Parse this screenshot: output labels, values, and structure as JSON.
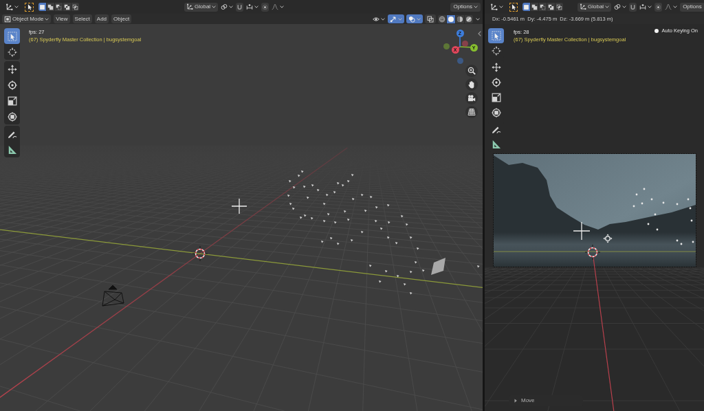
{
  "viewports": [
    {
      "kind": "perspective",
      "header": {
        "select_modes": [
          {
            "kind": "set",
            "selected": true
          },
          {
            "kind": "extend",
            "selected": false
          },
          {
            "kind": "subtract",
            "selected": false
          },
          {
            "kind": "invert",
            "selected": false
          },
          {
            "kind": "intersect",
            "selected": false
          }
        ],
        "orientation": "Global",
        "options": "Options",
        "options_caret": true,
        "mode": "Object Mode",
        "menus": [
          "View",
          "Select",
          "Add",
          "Object"
        ],
        "toggles": [
          {
            "kind": "visibility",
            "on": false
          },
          {
            "kind": "gizmos",
            "on": true
          },
          {
            "kind": "overlays",
            "on": true
          },
          {
            "kind": "xray",
            "on": false
          }
        ],
        "shading": [
          {
            "kind": "wireframe",
            "selected": false
          },
          {
            "kind": "solid",
            "selected": true
          },
          {
            "kind": "material",
            "selected": false
          },
          {
            "kind": "rendered",
            "selected": false
          }
        ]
      },
      "toolbar": [
        {
          "tools": [
            {
              "kind": "select",
              "selected": true
            },
            {
              "kind": "cursor",
              "selected": false
            }
          ]
        },
        {
          "tools": [
            {
              "kind": "move",
              "selected": false
            },
            {
              "kind": "rotate",
              "selected": false
            },
            {
              "kind": "scale",
              "selected": false
            },
            {
              "kind": "transform",
              "selected": false
            }
          ]
        },
        {
          "tools": [
            {
              "kind": "annotate",
              "selected": false
            },
            {
              "kind": "measure",
              "selected": false
            }
          ]
        }
      ],
      "info": {
        "fps": "fps: 27",
        "collection": "(67) Spyderfly Master Collection | bugsystemgoal"
      },
      "gizmo": {
        "axes": [
          {
            "label": "X",
            "color": "#e2465b"
          },
          {
            "label": "Y",
            "color": "#86bd2f"
          },
          {
            "label": "Z",
            "color": "#3d7ddb"
          }
        ]
      },
      "navigation": [
        {
          "kind": "zoom"
        },
        {
          "kind": "pan"
        },
        {
          "kind": "camera"
        },
        {
          "kind": "ortho"
        }
      ]
    },
    {
      "kind": "camera",
      "header": {
        "select_modes": [
          {
            "kind": "set",
            "selected": true
          },
          {
            "kind": "extend",
            "selected": false
          },
          {
            "kind": "subtract",
            "selected": false
          },
          {
            "kind": "invert",
            "selected": false
          },
          {
            "kind": "intersect",
            "selected": false
          }
        ],
        "orientation": "Global",
        "options": "Options",
        "options_caret": false,
        "readout": "Dx: -0.5461 m  Dy: -4.475 m  Dz: -3.669 m (5.813 m)"
      },
      "toolbar": [
        {
          "tools": [
            {
              "kind": "select",
              "selected": true
            },
            {
              "kind": "cursor",
              "selected": false
            }
          ]
        },
        {
          "tools": [
            {
              "kind": "move",
              "selected": false
            },
            {
              "kind": "rotate",
              "selected": false
            },
            {
              "kind": "scale",
              "selected": false
            },
            {
              "kind": "transform",
              "selected": false
            }
          ]
        },
        {
          "tools": [
            {
              "kind": "annotate",
              "selected": false
            },
            {
              "kind": "measure",
              "selected": false
            }
          ]
        }
      ],
      "info": {
        "fps": "fps: 28",
        "collection": "(67) Spyderfly Master Collection | bugsystemgoal"
      },
      "auto_keying": "Auto Keying On",
      "last_operator": {
        "label": "Move",
        "expanded": false
      }
    }
  ]
}
